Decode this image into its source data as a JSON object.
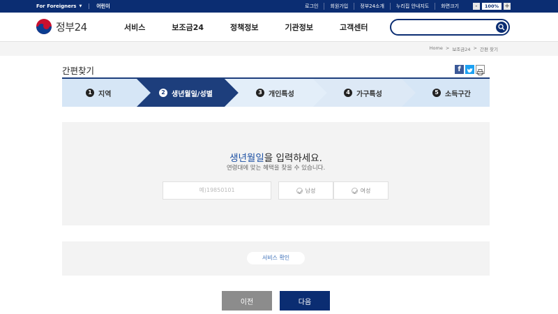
{
  "topbar": {
    "foreigners": "For Foreigners",
    "kids": "어린이",
    "links": [
      "로그인",
      "회원가입",
      "정부24소개",
      "누리집 안내지도",
      "화면크기"
    ],
    "font_minus": "-",
    "font_pct": "100%",
    "font_plus": "+"
  },
  "header": {
    "logo_text": "정부24",
    "nav": [
      "서비스",
      "보조금24",
      "정책정보",
      "기관정보",
      "고객센터"
    ],
    "search_placeholder": ""
  },
  "breadcrumb": [
    "Home",
    ">",
    "보조금24",
    ">",
    "간편 찾기"
  ],
  "page": {
    "title": "간편찾기",
    "share_fb": "f"
  },
  "steps": [
    {
      "num": "1",
      "label": "지역",
      "state": "done"
    },
    {
      "num": "2",
      "label": "생년월일/성별",
      "state": "active"
    },
    {
      "num": "3",
      "label": "개인특성",
      "state": "todo"
    },
    {
      "num": "4",
      "label": "가구특성",
      "state": "todo"
    },
    {
      "num": "5",
      "label": "소득구간",
      "state": "todo"
    }
  ],
  "form": {
    "title_highlight": "생년월일",
    "title_rest": "을 입력하세요.",
    "description": "연령대에 맞는 혜택을 찾을 수 있습니다.",
    "birth_placeholder": "예)19850101",
    "gender_male": "남성",
    "gender_female": "여성"
  },
  "result": {
    "pill_text": "서비스 확인"
  },
  "buttons": {
    "prev": "이전",
    "next": "다음"
  },
  "colors": {
    "brand_navy": "#0b2d72",
    "step_active": "#1d3e7c",
    "step_bg": "#d6e6f6",
    "highlight": "#1b4fa3",
    "prev_btn": "#8c8c8c"
  }
}
